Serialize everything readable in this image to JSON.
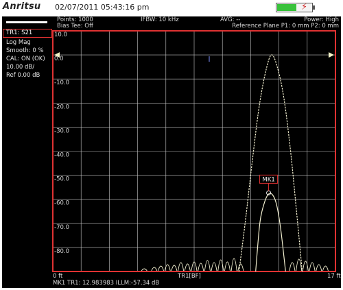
{
  "header": {
    "brand": "Anritsu",
    "datetime": "02/07/2011 05:43:16 pm",
    "battery_level": 0.55
  },
  "status": {
    "points": "Points: 1000",
    "bias_tee": "Bias Tee: Off",
    "ifbw": "IFBW: 10 kHz",
    "avg": "AVG: --",
    "power": "Power: High",
    "reference_plane": "Reference Plane P1: 0 mm P2: 0 mm"
  },
  "trace_panel": {
    "trace": "TR1: S21",
    "format": "Log Mag",
    "smooth": "Smooth: 0 %",
    "cal": "CAL: ON (OK)",
    "scale": "10.00 dB/",
    "ref": "Ref 0.00 dB"
  },
  "graph": {
    "x_start": "0 ft",
    "x_center": "TR1[BF]",
    "x_stop": "17 ft",
    "y_ticks": [
      "10.0",
      "0.0",
      "-10.0",
      "-20.0",
      "-30.0",
      "-40.0",
      "-50.0",
      "-60.0",
      "-70.0",
      "-80.0"
    ]
  },
  "marker": {
    "label": "MK1",
    "readout": "MK1 TR1:  12.983983 ILLM:-57.34 dB"
  },
  "colors": {
    "trace": "#f2efd0",
    "frame_border": "#e03232",
    "grid": "#c8c8c8",
    "ref_arrow": "#f4f4c8",
    "battery_fill": "#39c23c"
  },
  "chart_data": {
    "type": "line",
    "xlabel": "TR1[BF]",
    "ylabel": "",
    "xlim": [
      0,
      17
    ],
    "ylim": [
      -90,
      10
    ],
    "grid": true,
    "series": [
      {
        "x": [
          12.2,
          12.45,
          12.7,
          12.95,
          13.2,
          13.45,
          13.7,
          14.0
        ],
        "y": [
          -90,
          -70,
          -62,
          -58,
          -58,
          -62,
          -72,
          -90
        ]
      },
      {
        "x": [
          11.2,
          11.6,
          12.0,
          12.4,
          12.8,
          13.15,
          13.5,
          13.9,
          14.3,
          14.7,
          15.0
        ],
        "y": [
          -90,
          -68,
          -44,
          -22,
          -7,
          0,
          -5,
          -18,
          -40,
          -68,
          -90
        ]
      }
    ],
    "markers": [
      {
        "name": "MK1",
        "x": 12.98,
        "y": -57.34
      }
    ]
  }
}
